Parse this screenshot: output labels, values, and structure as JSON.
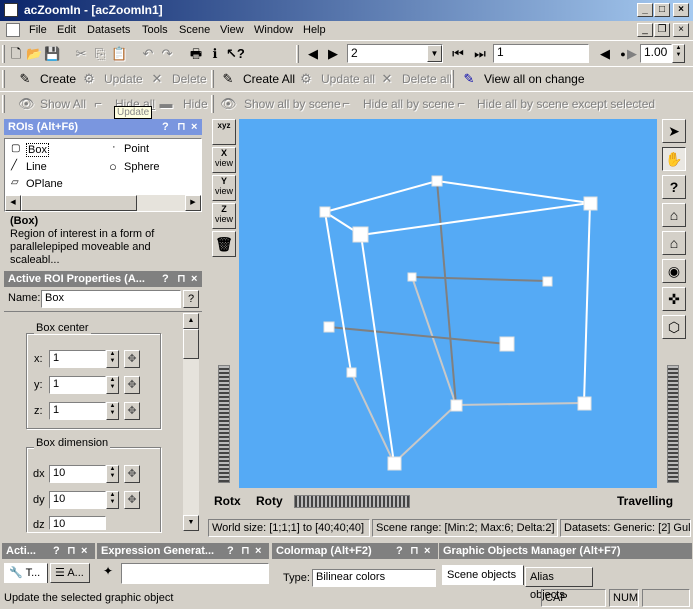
{
  "window": {
    "title": "acZoomIn - [acZoomIn1]",
    "min": "_",
    "max": "□",
    "close": "×"
  },
  "menu": {
    "items": [
      "File",
      "Edit",
      "Datasets",
      "Tools",
      "Scene",
      "View",
      "Window",
      "Help"
    ]
  },
  "toolbar1": {
    "frame_value": "2",
    "step_value": "1",
    "speed_value": "1.00"
  },
  "toolbar2": {
    "create": "Create",
    "update": "Update",
    "delete": "Delete",
    "create_all": "Create All",
    "update_all": "Update all",
    "delete_all": "Delete all",
    "view_all_on_change": "View all on change"
  },
  "toolbar3": {
    "show_all": "Show All",
    "hide_all": "Hide all",
    "hide_tooltip": "Update",
    "hide": "Hide",
    "show_all_by_scene": "Show all by scene",
    "hide_all_by_scene": "Hide all by scene",
    "hide_all_except": "Hide all by scene except selected"
  },
  "rois_panel": {
    "title": "ROIs (Alt+F6)",
    "buttons": "? ⊓ ×",
    "items": [
      "Box",
      "Point",
      "Line",
      "Sphere",
      "OPlane"
    ],
    "desc_title": "(Box)",
    "desc_text": "Region of interest in a form of parallelepiped moveable and scaleabl..."
  },
  "roi_props": {
    "title": "Active ROI Properties (A...",
    "buttons": "? ⊓ ×",
    "name_label": "Name:",
    "name_value": "Box",
    "help": "?",
    "box_center": "Box center",
    "x_label": "x:",
    "x_value": "1",
    "y_label": "y:",
    "y_value": "1",
    "z_label": "z:",
    "z_value": "1",
    "box_dimension": "Box dimension",
    "dx_label": "dx",
    "dx_value": "10",
    "dy_label": "dy",
    "dy_value": "10",
    "dz_label": "dz",
    "dz_value": "10"
  },
  "view_toolbar": {
    "xyz": "xyz",
    "x_view": "X",
    "x_view_sub": "view",
    "y_view": "Y",
    "y_view_sub": "view",
    "z_view": "Z",
    "z_view_sub": "view"
  },
  "viewport": {
    "rotx": "Rotx",
    "roty": "Roty",
    "travelling": "Travelling",
    "bg_color": "#55aaf5"
  },
  "status_row": {
    "world_size": "World size: [1;1;1] to [40;40;40]",
    "scene_range": "Scene range: [Min:2; Max:6; Delta:2]",
    "datasets": "Datasets: Generic: [2] Gul"
  },
  "bottom_panels": {
    "actions": "Acti...",
    "expression": "Expression Generat...",
    "colormap": "Colormap (Alt+F2)",
    "gom": "Graphic Objects Manager (Alt+F7)",
    "tab_t": "T...",
    "tab_a": "A...",
    "type_label": "Type:",
    "type_value": "Bilinear colors",
    "scene_objects": "Scene objects",
    "alias_objects": "Alias objects"
  },
  "statusbar": {
    "message": "Update the selected graphic object",
    "cap": "CAP",
    "num": "NUM"
  }
}
